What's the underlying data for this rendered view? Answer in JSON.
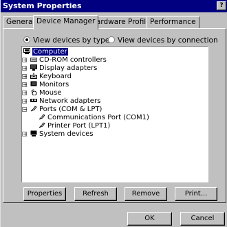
{
  "window": {
    "title": "System Properties",
    "help_btn": "?"
  },
  "tabs": [
    {
      "label": "General",
      "active": false
    },
    {
      "label": "Device Manager",
      "active": true
    },
    {
      "label": "Hardware Profiles",
      "active": false
    },
    {
      "label": "Performance",
      "active": false
    }
  ],
  "view": {
    "by_type": "View devices by type",
    "by_connection": "View devices by connection",
    "selected": "by_type"
  },
  "tree": {
    "root": "Computer",
    "items": [
      {
        "label": "CD-ROM controllers",
        "icon": "cdrom-icon",
        "expander": "+"
      },
      {
        "label": "Display adapters",
        "icon": "display-icon",
        "expander": "+"
      },
      {
        "label": "Keyboard",
        "icon": "keyboard-icon",
        "expander": "+"
      },
      {
        "label": "Monitors",
        "icon": "monitor-icon",
        "expander": "+"
      },
      {
        "label": "Mouse",
        "icon": "mouse-icon",
        "expander": "+"
      },
      {
        "label": "Network adapters",
        "icon": "network-icon",
        "expander": "+"
      },
      {
        "label": "Ports (COM & LPT)",
        "icon": "port-icon",
        "expander": "−"
      },
      {
        "label": "Communications Port (COM1)",
        "icon": "port-icon",
        "expander": ""
      },
      {
        "label": "Printer Port (LPT1)",
        "icon": "port-icon",
        "expander": ""
      },
      {
        "label": "System devices",
        "icon": "system-icon",
        "expander": "+"
      }
    ]
  },
  "buttons": {
    "properties": "Properties",
    "refresh": "Refresh",
    "remove": "Remove",
    "print": "Print...",
    "ok": "OK",
    "cancel": "Cancel"
  }
}
